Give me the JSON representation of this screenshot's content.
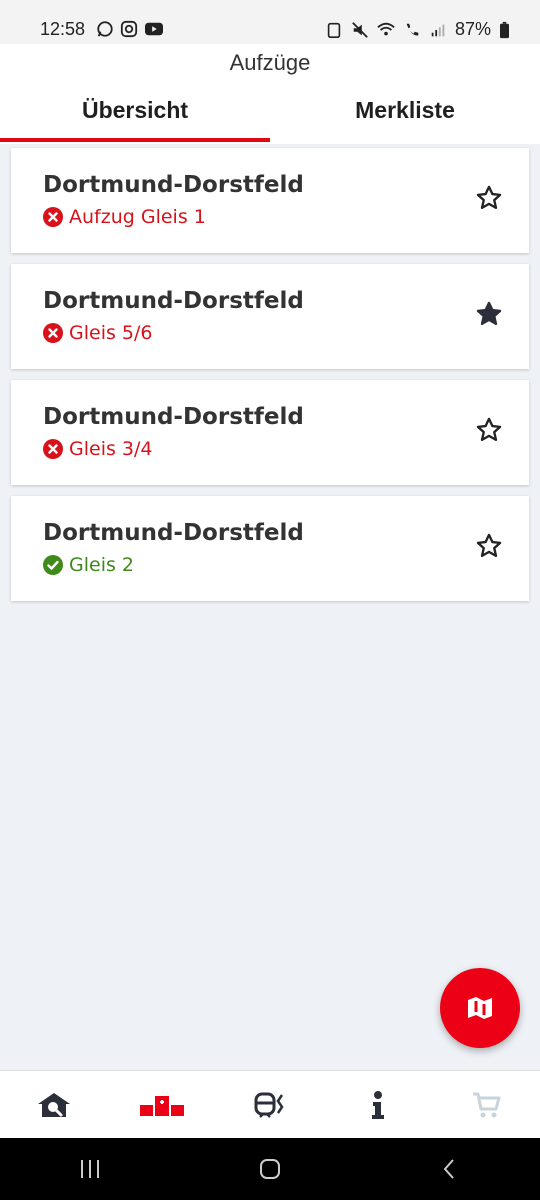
{
  "status_bar": {
    "time": "12:58",
    "battery": "87%"
  },
  "header": {
    "title": "Aufzüge"
  },
  "tabs": [
    {
      "label": "Übersicht",
      "active": true
    },
    {
      "label": "Merkliste",
      "active": false
    }
  ],
  "elevators": [
    {
      "station": "Dortmund-Dorstfeld",
      "name": "Aufzug Gleis 1",
      "status": "out_of_order",
      "favorite": false
    },
    {
      "station": "Dortmund-Dorstfeld",
      "name": "Gleis 5/6",
      "status": "out_of_order",
      "favorite": true
    },
    {
      "station": "Dortmund-Dorstfeld",
      "name": "Gleis 3/4",
      "status": "out_of_order",
      "favorite": false
    },
    {
      "station": "Dortmund-Dorstfeld",
      "name": "Gleis 2",
      "status": "ok",
      "favorite": false
    }
  ],
  "colors": {
    "accent": "#e30613",
    "error": "#d8121a",
    "ok": "#3f8a1a",
    "fab": "#ec0016",
    "background": "#eef1f5"
  },
  "bottom_nav": [
    {
      "icon": "station-search-icon"
    },
    {
      "icon": "elevator-icon",
      "active": true
    },
    {
      "icon": "train-timetable-icon"
    },
    {
      "icon": "info-icon"
    },
    {
      "icon": "shopping-cart-icon",
      "disabled": true
    }
  ]
}
